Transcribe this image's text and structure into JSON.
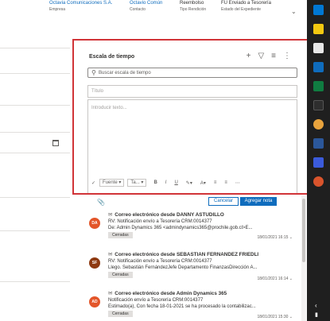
{
  "header": {
    "fields": [
      {
        "value": "Octavia Comunicaciones S.A.",
        "label": "Empresa",
        "link": true
      },
      {
        "value": "Octavio Común",
        "label": "Contacto",
        "link": true
      },
      {
        "value": "Reembolso",
        "label": "Tipo Rendición",
        "link": false
      },
      {
        "value": "FU Enviado a Tesorería",
        "label": "Estado del Expediente",
        "link": false
      }
    ]
  },
  "timeline": {
    "title": "Escala de tiempo",
    "search_placeholder": "Buscar escala de tiempo",
    "note_title_placeholder": "Título",
    "note_body_placeholder": "Introducir texto...",
    "toolbar": {
      "font": "Fuente",
      "size": "Ta..."
    },
    "cancel_label": "Cancelar",
    "add_note_label": "Agregar nota"
  },
  "activities": [
    {
      "initials": "DA",
      "avatar_color": "#e3562a",
      "title": "Correo electrónico desde DANNY ASTUDILLO",
      "line1": "RV: Notificación envío a Tesorería CRM:0014377",
      "line2": "De: Admin Dynamics 365 <admindynamics365@prochile.gob.cl>E...",
      "status": "Cerradas",
      "timestamp": "18/01/2021 16:15"
    },
    {
      "initials": "SF",
      "avatar_color": "#8e3a12",
      "title": "Correo electrónico desde SEBASTIAN FERNANDEZ FRIEDLI",
      "line1": "RV: Notificación envío a Tesorería CRM:0014377",
      "line2": "Llego. Sebastián FernándezJefe Departamento FinanzasDirección A...",
      "status": "Cerradas",
      "timestamp": "18/01/2021 16:14"
    },
    {
      "initials": "AD",
      "avatar_color": "#e3562a",
      "title": "Correo electrónico desde Admin Dynamics 365",
      "line1": "Notificación envío a Tesorería CRM:0014377",
      "line2": "Estimado(a), Con fecha 18-01-2021 se ha procesado la contabilizac...",
      "status": "Cerradas",
      "timestamp": "18/01/2021 15:30"
    }
  ],
  "colors": {
    "accent": "#0f6cbd",
    "highlight": "#d13438",
    "taskbar": "#1f1f1f"
  }
}
